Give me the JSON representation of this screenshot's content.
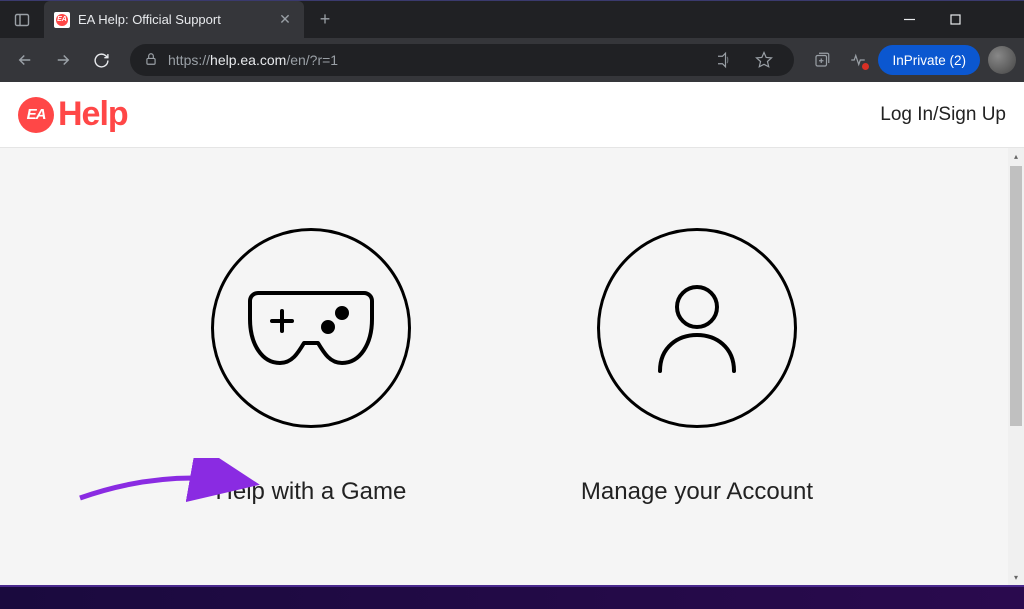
{
  "browser": {
    "tab": {
      "title": "EA Help: Official Support",
      "favicon_label": "EA"
    },
    "url": {
      "protocol": "https://",
      "host": "help.ea.com",
      "path": "/en/?r=1"
    },
    "inprivate_label": "InPrivate (2)"
  },
  "site": {
    "logo_badge": "EA",
    "logo_text": "Help",
    "login_label": "Log In/Sign Up"
  },
  "options": {
    "help_game": "Help with a Game",
    "manage_account": "Manage your Account"
  }
}
